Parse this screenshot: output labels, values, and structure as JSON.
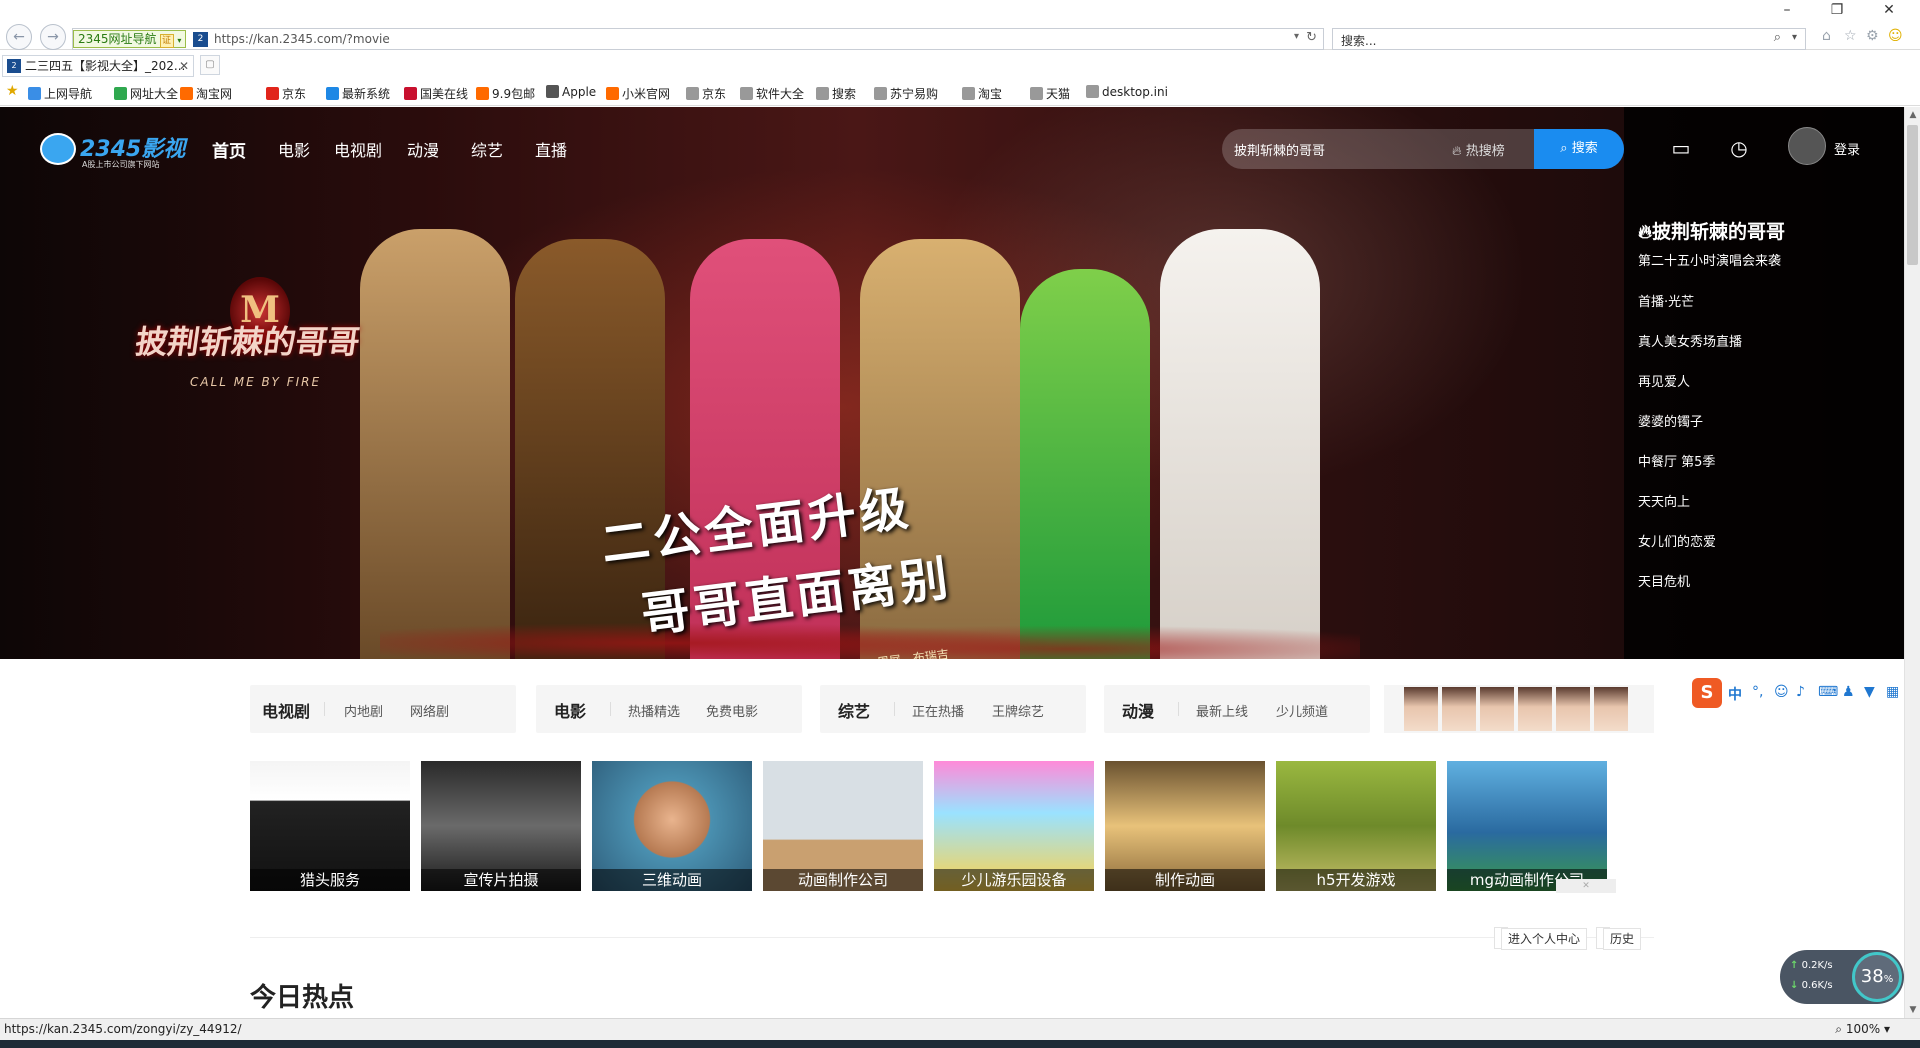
{
  "browser": {
    "nav_badge": "2345网址导航",
    "nav_badge_tag": "证",
    "url": "https://kan.2345.com/?movie",
    "search_placeholder": "搜索...",
    "tab_title": "二三四五【影视大全】_202...",
    "status_url": "https://kan.2345.com/zongyi/zy_44912/",
    "zoom": "100%"
  },
  "bookmarks": [
    {
      "label": "上网导航",
      "color": "#3a8ee6"
    },
    {
      "label": "网址大全",
      "color": "#2fa84f"
    },
    {
      "label": "淘宝网",
      "color": "#ff6a00"
    },
    {
      "label": "京东",
      "color": "#e1251b"
    },
    {
      "label": "最新系统",
      "color": "#1e88e5"
    },
    {
      "label": "国美在线",
      "color": "#c8102e"
    },
    {
      "label": "9.9包邮",
      "color": "#ff6a00"
    },
    {
      "label": "Apple",
      "color": "#555555"
    },
    {
      "label": "小米官网",
      "color": "#ff6a00"
    },
    {
      "label": "京东",
      "color": "#999999"
    },
    {
      "label": "软件大全",
      "color": "#999999"
    },
    {
      "label": "搜索",
      "color": "#999999"
    },
    {
      "label": "苏宁易购",
      "color": "#999999"
    },
    {
      "label": "淘宝",
      "color": "#999999"
    },
    {
      "label": "天猫",
      "color": "#999999"
    },
    {
      "label": "desktop.ini",
      "color": "#999999"
    }
  ],
  "site": {
    "brand": "2345影视",
    "brand_sub": "A股上市公司旗下网站",
    "nav": [
      "首页",
      "电影",
      "电视剧",
      "动漫",
      "综艺",
      "直播"
    ],
    "search_value": "披荆斩棘的哥哥",
    "hot_label": "热搜榜",
    "search_button": "搜索",
    "login": "登录"
  },
  "hero": {
    "show_logo_text": "披荆斩棘的哥哥",
    "show_logo_en": "CALL ME BY FIRE",
    "slogan_line1": "二公全面升级",
    "slogan_line2": "哥哥直面离别",
    "caption": "《往事只能回味》陈小春、谢天华、张智霖、梁汉文、周展、布瑞吉"
  },
  "hotlist": {
    "title": "披荆斩棘的哥哥",
    "subtitle": "第二十五小时演唱会来袭",
    "items": [
      "首播·光芒",
      "真人美女秀场直播",
      "再见爱人",
      "婆婆的镯子",
      "中餐厅 第5季",
      "天天向上",
      "女儿们的恋爱",
      "天目危机"
    ]
  },
  "categories": [
    {
      "main": "电视剧",
      "sub1": "内地剧",
      "sub2": "网络剧"
    },
    {
      "main": "电影",
      "sub1": "热播精选",
      "sub2": "免费电影"
    },
    {
      "main": "综艺",
      "sub1": "正在热播",
      "sub2": "王牌综艺"
    },
    {
      "main": "动漫",
      "sub1": "最新上线",
      "sub2": "少儿频道"
    }
  ],
  "ads": [
    "猎头服务",
    "宣传片拍摄",
    "三维动画",
    "动画制作公司",
    "少儿游乐园设备",
    "制作动画",
    "h5开发游戏",
    "mg动画制作公司"
  ],
  "user_links": {
    "center": "进入个人中心",
    "history": "历史"
  },
  "section_title": "今日热点",
  "speed_widget": {
    "up": "0.2",
    "down": "0.6",
    "unit": "K/s",
    "percent": "38",
    "percent_sign": "%"
  },
  "colors": {
    "accent": "#1a8cf0",
    "ime": "#ef5a24"
  }
}
